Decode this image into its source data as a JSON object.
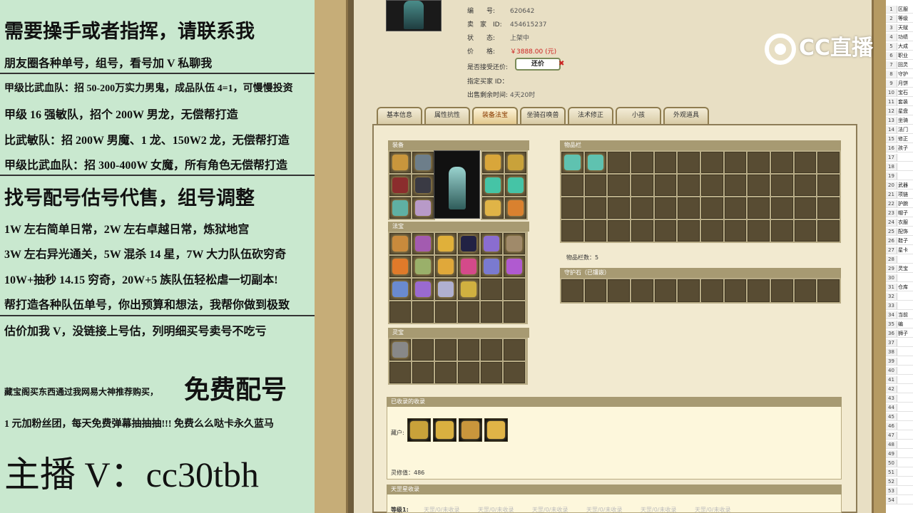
{
  "overlay": {
    "lines": [
      "需要操手或者指挥，请联系我",
      "朋友圈各种单号，组号，看号加 V 私聊我",
      "甲级比武血队：招 50-200万实力男鬼，成品队伍 4=1，可慢慢投资",
      "甲级 16 强敏队，招个 200W 男龙，无偿帮打造",
      "比武敏队：招 200W 男魔、1 龙、150W2 龙，无偿帮打造",
      "甲级比武血队：招 300-400W 女魔，所有角色无偿帮打造",
      "找号配号估号代售，组号调整",
      "1W 左右简单日常，2W 左右卓越日常，炼狱地宫",
      "3W 左右异光通关，5W 混杀 14 星，7W 大力队伍砍穷奇",
      "10W+抽秒 14.15 穷奇，20W+5 族队伍轻松虐一切副本!",
      "帮打造各种队伍单号，你出预算和想法，我帮你做到极致",
      "估价加我 V，没链接上号估，列明细买号卖号不吃亏"
    ],
    "promo_small": "藏宝阁买东西通过我网易大神推荐购买，",
    "promo_big": "免费配号",
    "fans_line": "1 元加粉丝团，每天免费弹幕抽抽抽!!! 免费么么哒卡永久蓝马",
    "host_line": "主播 V：cc30tbh"
  },
  "listing": {
    "rows": [
      {
        "label": "编　　号:",
        "value": "620642"
      },
      {
        "label": "卖　家　ID:",
        "value": "454615237"
      },
      {
        "label": "状　　态:",
        "value": "上架中"
      },
      {
        "label": "价　　格:",
        "value": "￥3888.00 (元)"
      },
      {
        "label": "是否接受还价:",
        "value": ""
      },
      {
        "label": "指定买家 ID：",
        "value": ""
      },
      {
        "label": "出售剩余时间:",
        "value": "4天20时"
      }
    ],
    "haggle_button": "还价"
  },
  "tabs": [
    "基本信息",
    "属性抗性",
    "装备法宝",
    "坐骑召唤兽",
    "法术修正",
    "小孩",
    "外观道具"
  ],
  "sections": {
    "equip": "装备",
    "fabao": "法宝",
    "inventory": "物品栏",
    "inventory_count": "物品栏数：5",
    "guard": "守护石（已镶嵌）",
    "lingbao": "灵宝",
    "collected": "已收录的收录",
    "lingbao_label": "藏户:",
    "lingxiu": "灵修值：486",
    "tianzhu": "天罡星收录",
    "tianzhu_row": "等级1:",
    "tianzhu_items": [
      "天罡/0/未收录",
      "天罡/0/未收录",
      "天罡/0/未收录",
      "天罡/0/未收录",
      "天罡/0/未收录",
      "天罡/0/未收录"
    ]
  },
  "logo": {
    "text": "CC直播"
  },
  "sheet": {
    "rows": [
      [
        "1",
        "区服"
      ],
      [
        "2",
        "等级"
      ],
      [
        "3",
        "天赋"
      ],
      [
        "4",
        "功绩"
      ],
      [
        "5",
        "大成"
      ],
      [
        "6",
        "职业"
      ],
      [
        "7",
        "回灵"
      ],
      [
        "8",
        "守护"
      ],
      [
        "9",
        "月饼"
      ],
      [
        "10",
        "宝石"
      ],
      [
        "11",
        "套装"
      ],
      [
        "12",
        "星盘"
      ],
      [
        "13",
        "坐骑"
      ],
      [
        "14",
        "法门"
      ],
      [
        "15",
        "修正"
      ],
      [
        "16",
        "孩子"
      ],
      [
        "17",
        ""
      ],
      [
        "18",
        ""
      ],
      [
        "19",
        ""
      ],
      [
        "20",
        "武器"
      ],
      [
        "21",
        "项链"
      ],
      [
        "22",
        "护腕"
      ],
      [
        "23",
        "帽子"
      ],
      [
        "24",
        "衣服"
      ],
      [
        "25",
        "配饰"
      ],
      [
        "26",
        "鞋子"
      ],
      [
        "27",
        "星卡"
      ],
      [
        "28",
        ""
      ],
      [
        "29",
        "灵宝"
      ],
      [
        "30",
        ""
      ],
      [
        "31",
        "仓库"
      ],
      [
        "32",
        ""
      ],
      [
        "33",
        ""
      ],
      [
        "34",
        "当前"
      ],
      [
        "35",
        "编"
      ],
      [
        "36",
        "狮子"
      ],
      [
        "37",
        ""
      ],
      [
        "38",
        ""
      ],
      [
        "39",
        ""
      ],
      [
        "40",
        ""
      ],
      [
        "41",
        ""
      ],
      [
        "42",
        ""
      ],
      [
        "43",
        ""
      ],
      [
        "44",
        ""
      ],
      [
        "45",
        ""
      ],
      [
        "46",
        ""
      ],
      [
        "47",
        ""
      ],
      [
        "48",
        ""
      ],
      [
        "49",
        ""
      ],
      [
        "50",
        ""
      ],
      [
        "51",
        ""
      ],
      [
        "52",
        ""
      ],
      [
        "53",
        ""
      ],
      [
        "54",
        ""
      ]
    ]
  },
  "colors": {
    "accent_price": "#cc1f1f",
    "panel_bg": "#c9e8cf"
  }
}
